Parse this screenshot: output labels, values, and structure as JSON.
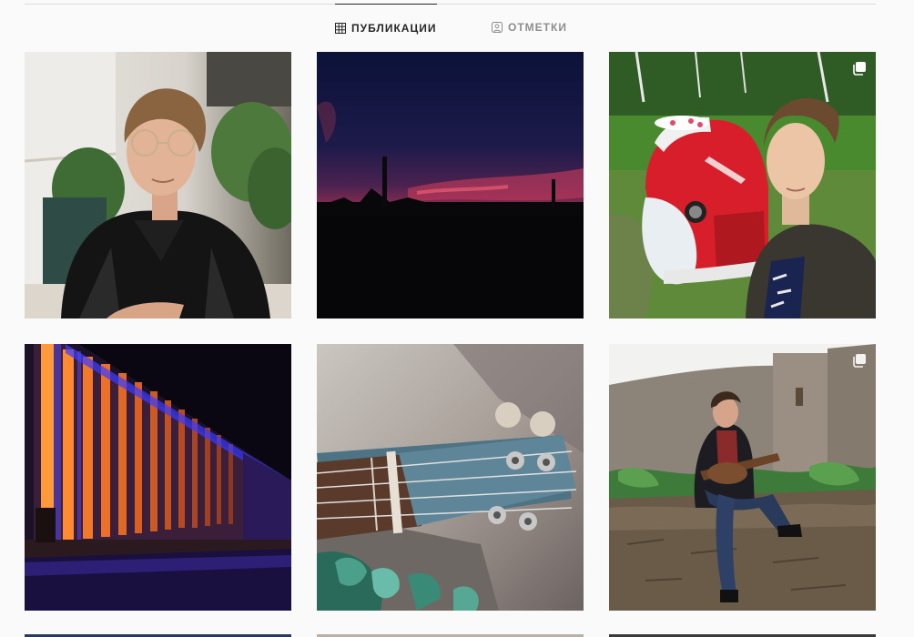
{
  "tabs": [
    {
      "label": "ПУБЛИКАЦИИ",
      "icon": "grid-icon",
      "active": true
    },
    {
      "label": "ОТМЕТКИ",
      "icon": "tagged-person-icon",
      "active": false
    }
  ],
  "posts": [
    {
      "subject": "portrait-glasses-leather-jacket",
      "multi": false
    },
    {
      "subject": "dark-sunset-sky",
      "multi": false
    },
    {
      "subject": "selfie-red-vintage-car",
      "multi": true
    },
    {
      "subject": "illuminated-building-night",
      "multi": false
    },
    {
      "subject": "ukulele-headstock-closeup",
      "multi": false
    },
    {
      "subject": "ukulele-player-on-stone-wall",
      "multi": true
    }
  ],
  "colors": {
    "background": "#fafafa",
    "active_tab": "#262626",
    "inactive_tab": "#8e8e8e",
    "divider": "#dbdbdb"
  }
}
